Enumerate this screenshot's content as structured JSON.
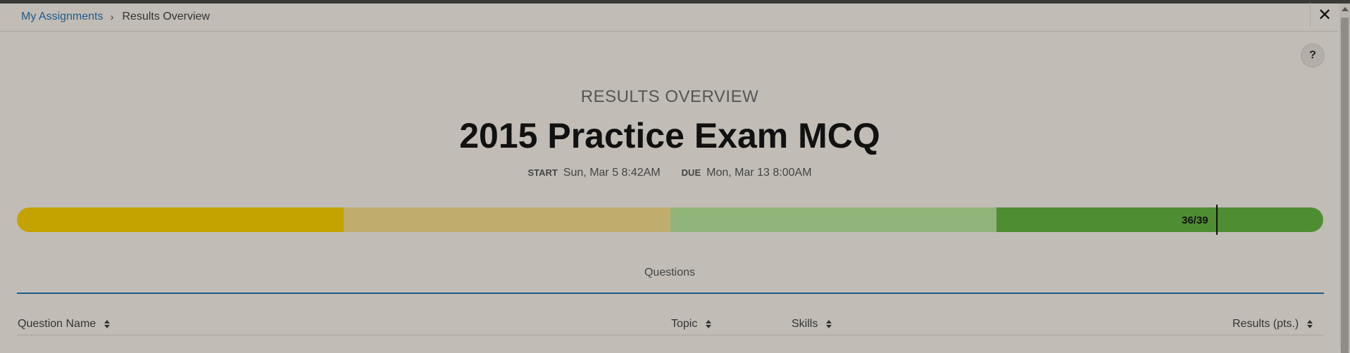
{
  "breadcrumb": {
    "link_label": "My Assignments",
    "separator": "›",
    "current": "Results Overview"
  },
  "window": {
    "close_label": "✕",
    "help_label": "?"
  },
  "header": {
    "overview_label": "RESULTS OVERVIEW",
    "title": "2015 Practice Exam MCQ",
    "start_key": "START",
    "start_value": "Sun, Mar 5 8:42AM",
    "due_key": "DUE",
    "due_value": "Mon, Mar 13 8:00AM"
  },
  "score": {
    "label": "36/39",
    "earned": 36,
    "total": 39,
    "segment_colors": [
      "#c4a200",
      "#c0ac6c",
      "#90b57a",
      "#4f8d33"
    ]
  },
  "tabs": {
    "questions_label": "Questions"
  },
  "table": {
    "columns": [
      {
        "label": "Question Name"
      },
      {
        "label": "Topic"
      },
      {
        "label": "Skills"
      },
      {
        "label": "Results (pts.)"
      }
    ]
  }
}
